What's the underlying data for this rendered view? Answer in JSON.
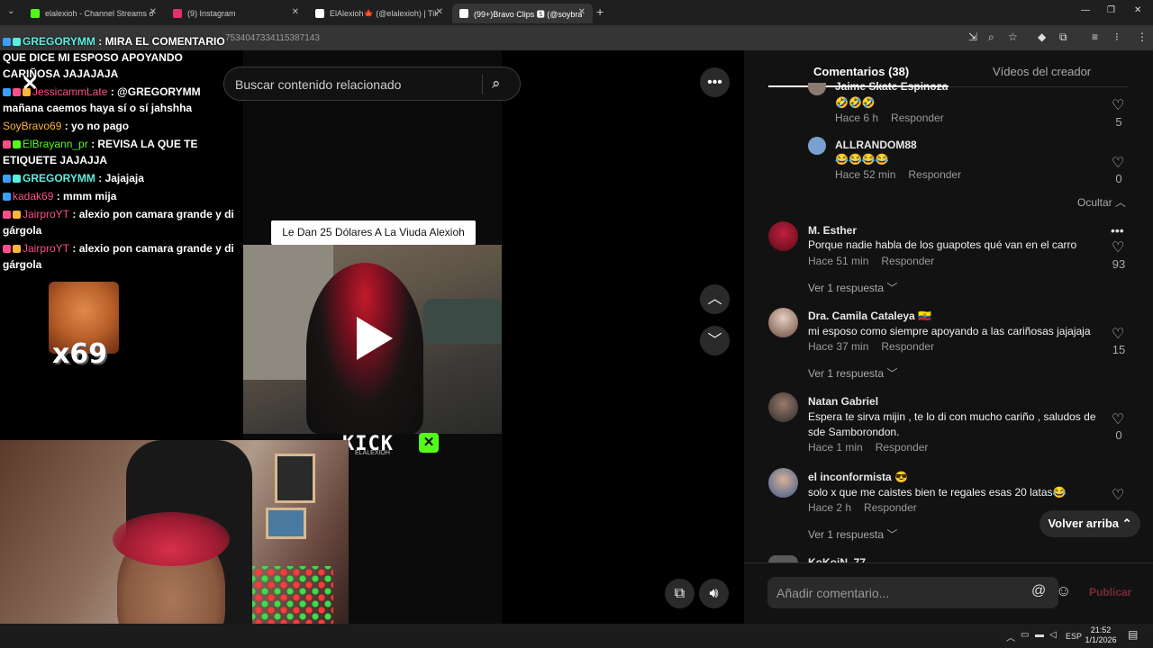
{
  "browser": {
    "tabs": [
      {
        "label": "elalexioh - Channel Streams on",
        "color": "#53fc18"
      },
      {
        "label": "(9) Instagram",
        "color": "#e1306c"
      },
      {
        "label": "ElAlexioh🍁 (@elalexioh) | TikT",
        "color": "#ffffff"
      },
      {
        "label": "(99+)Bravo Clips 🆂 (@soybrav",
        "color": "#ffffff"
      }
    ],
    "new_tab": "+",
    "url": "...tiktok.com/@soybravo/video/7534047334115387143",
    "url_visible": "7534047334115387143"
  },
  "search": {
    "placeholder": "Buscar contenido relacionado"
  },
  "video": {
    "title": "Le Dan 25 Dólares A La Viuda Alexioh",
    "kick": "KICK",
    "kick_sub": "ELALEXIOH"
  },
  "chat": [
    {
      "user": "GREGORYMM",
      "color": "#59f0e0",
      "text": ": MIRA EL COMENTARIO QUE DICE MI ESPOSO APOYANDO CARIÑOSA JAJAJAJA"
    },
    {
      "user": "JessicammLate",
      "color": "#ff4f8a",
      "text": ": @GREGORYMM mañana caemos haya sí o sí jahshha"
    },
    {
      "user": "SoyBravo69",
      "color": "#ffb43a",
      "text": ": yo no pago"
    },
    {
      "user": "ElBrayann_pr",
      "color": "#53fc18",
      "text": ": REVISA LA QUE TE ETIQUETE JAJAJJA"
    },
    {
      "user": "GREGORYMM",
      "color": "#59f0e0",
      "text": ": Jajajaja"
    },
    {
      "user": "kadak69",
      "color": "#ff4f8a",
      "text": ": mmm mija"
    },
    {
      "user": "JairproYT",
      "color": "#ff4f8a",
      "text": ": alexio pon camara grande y di gárgola"
    },
    {
      "user": "JairproYT",
      "color": "#ff4f8a",
      "text": ": alexio pon camara grande y di gárgola"
    }
  ],
  "emote_text": "x69",
  "panel": {
    "tab_comments": "Comentarios (38)",
    "tab_videos": "Vídeos del creador",
    "hide": "Ocultar",
    "back_to_top": "Volver arriba",
    "add_placeholder": "Añadir comentario...",
    "publish": "Publicar"
  },
  "comments": [
    {
      "name": "Jaime Skate Espinoza",
      "text": "🤣🤣🤣",
      "time": "Hace 6 h",
      "reply": "Responder",
      "likes": "5"
    },
    {
      "name": "ALLRANDOM88",
      "text": "😂😂😂😂",
      "time": "Hace 52 min",
      "reply": "Responder",
      "likes": "0"
    },
    {
      "name": "M. Esther",
      "text": "Porque nadie habla de los guapotes qué van en el carro",
      "time": "Hace 51 min",
      "reply": "Responder",
      "likes": "93",
      "replies": "Ver 1 respuesta"
    },
    {
      "name": "Dra. Camila Cataleya 🇪🇨",
      "text": "mi esposo como siempre apoyando a las cariñosas jajajaja",
      "time": "Hace 37 min",
      "reply": "Responder",
      "likes": "15",
      "replies": "Ver 1 respuesta"
    },
    {
      "name": "Natan Gabriel",
      "text": "Espera te sirva mijin , te lo di con mucho cariño , saludos de sde Samborondon.",
      "time": "Hace 1 min",
      "reply": "Responder",
      "likes": "0"
    },
    {
      "name": "el inconformista 😎",
      "text": "solo x que me caistes bien te regales esas 20 latas😂",
      "time": "Hace 2 h",
      "reply": "Responder",
      "replies": "Ver 1 respuesta"
    },
    {
      "name": "KoKoiN_77"
    }
  ],
  "taskbar": {
    "lang": "ESP",
    "time": "21:52",
    "date": "1/1/2026"
  },
  "colors": {
    "accent": "#fe2c55",
    "kick_green": "#53fc18"
  }
}
